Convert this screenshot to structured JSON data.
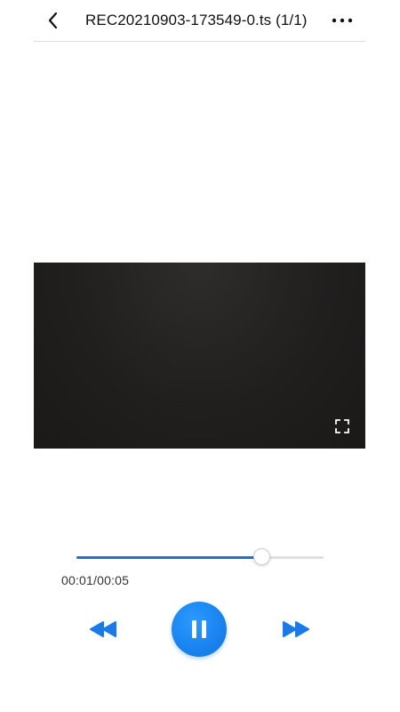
{
  "header": {
    "title": "REC20210903-173549-0.ts (1/1)",
    "back_icon": "chevron-left-icon",
    "more_icon": "more-horizontal-icon"
  },
  "video": {
    "fullscreen_icon": "fullscreen-icon"
  },
  "player": {
    "time_display": "00:01/00:05",
    "progress_fraction": 0.75,
    "state": "playing",
    "rewind_icon": "rewind-icon",
    "pause_icon": "pause-icon",
    "forward_icon": "fast-forward-icon"
  },
  "colors": {
    "accent": "#1a73d9",
    "track": "#e0e0e0",
    "video_bg": "#201f1e"
  }
}
